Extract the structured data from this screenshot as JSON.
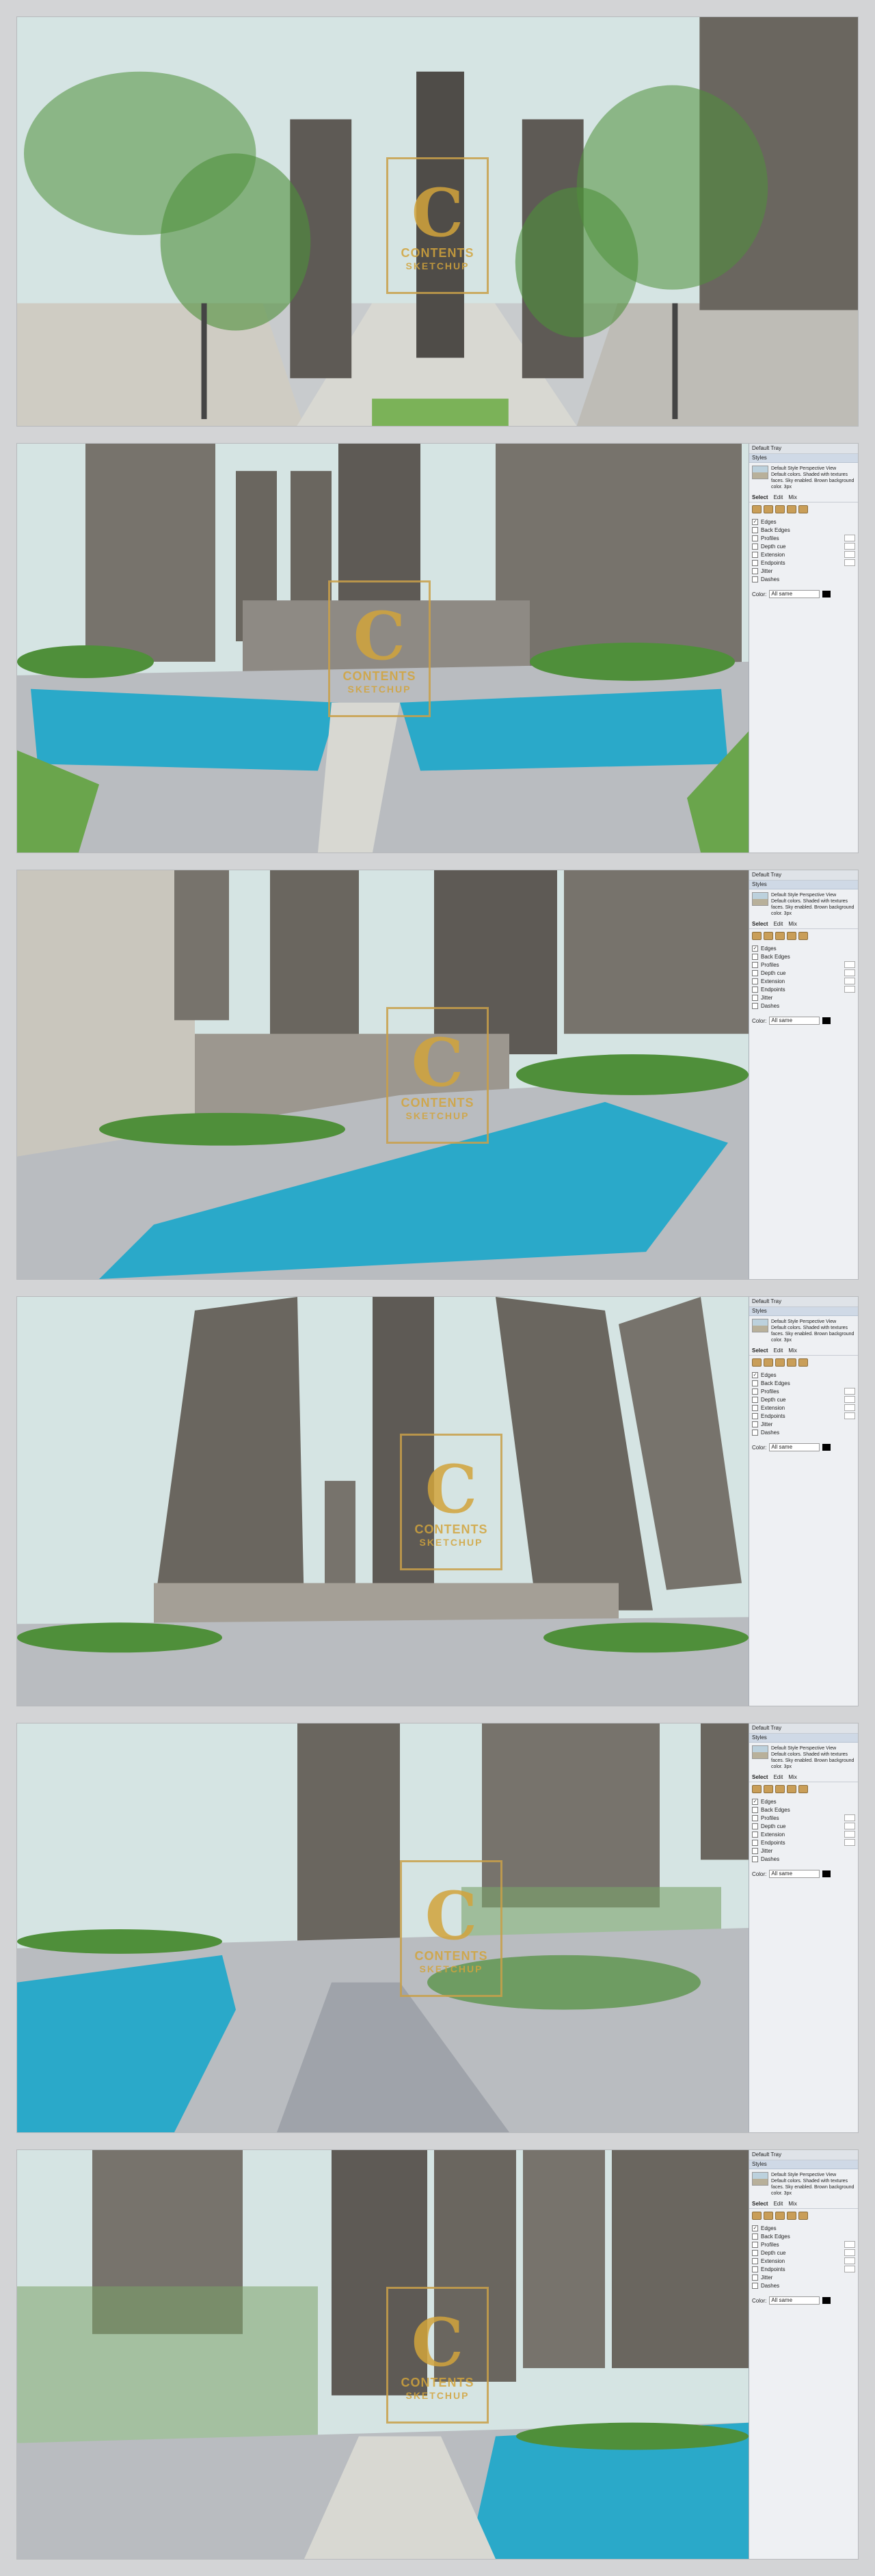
{
  "logo": {
    "letter": "C",
    "word": "CONTENTS",
    "word2": "SKETCHUP"
  },
  "styles_panel": {
    "tray_title": "Default Tray",
    "section": "Styles",
    "style_name": "Default Style Perspective View",
    "style_desc": "Default colors. Shaded with textures faces. Sky enabled. Brown background color. 3px",
    "tabs": [
      "Select",
      "Edit",
      "Mix"
    ],
    "options": [
      {
        "label": "Edges",
        "checked": true
      },
      {
        "label": "Back Edges",
        "checked": false
      },
      {
        "label": "Profiles",
        "checked": false
      },
      {
        "label": "Depth cue",
        "checked": false
      },
      {
        "label": "Extension",
        "checked": false
      },
      {
        "label": "Endpoints",
        "checked": false
      },
      {
        "label": "Jitter",
        "checked": false
      },
      {
        "label": "Dashes",
        "checked": false
      }
    ],
    "color_label": "Color:",
    "color_value": "All same"
  },
  "colors": {
    "sky": "#d7e6e6",
    "tower": "#77736c",
    "tower_dark": "#4e4b47",
    "water": "#2aa9c9",
    "tree": "#4f8f3a",
    "pave": "#b9bcc0",
    "gold": "#d2a43c"
  }
}
